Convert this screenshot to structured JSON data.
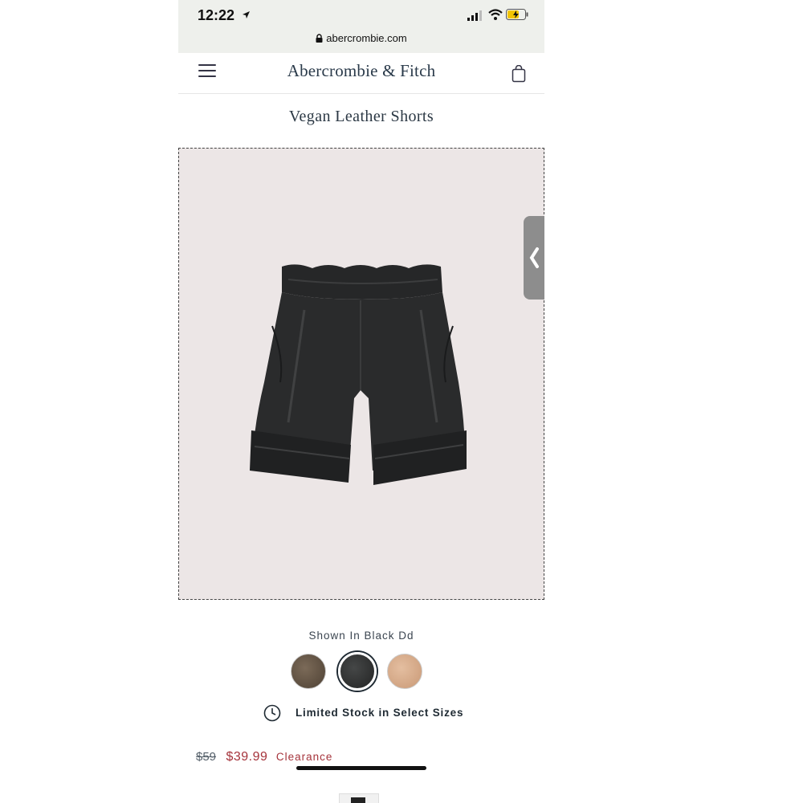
{
  "status_bar": {
    "time": "12:22",
    "url": "abercrombie.com",
    "icons": [
      "location-arrow-icon",
      "signal-icon",
      "wifi-icon",
      "battery-charging-icon",
      "lock-icon"
    ]
  },
  "header": {
    "brand": "Abercrombie & Fitch",
    "icons": [
      "menu-icon",
      "shopping-bag-icon"
    ]
  },
  "product": {
    "title": "Vegan Leather Shorts",
    "shown_in": "Shown In Black Dd",
    "swatches": [
      {
        "name": "brown",
        "color": "#5c4d3f"
      },
      {
        "name": "black",
        "color": "#2f3030",
        "selected": true
      },
      {
        "name": "tan",
        "color": "#d9ae8c"
      }
    ],
    "stock_note": "Limited Stock in Select Sizes",
    "price": {
      "original": "$59",
      "sale": "$39.99",
      "tag": "Clearance"
    }
  },
  "colors": {
    "sale_red": "#a5333b",
    "navy_text": "#1f2a33",
    "image_bg": "#ece6e6"
  }
}
